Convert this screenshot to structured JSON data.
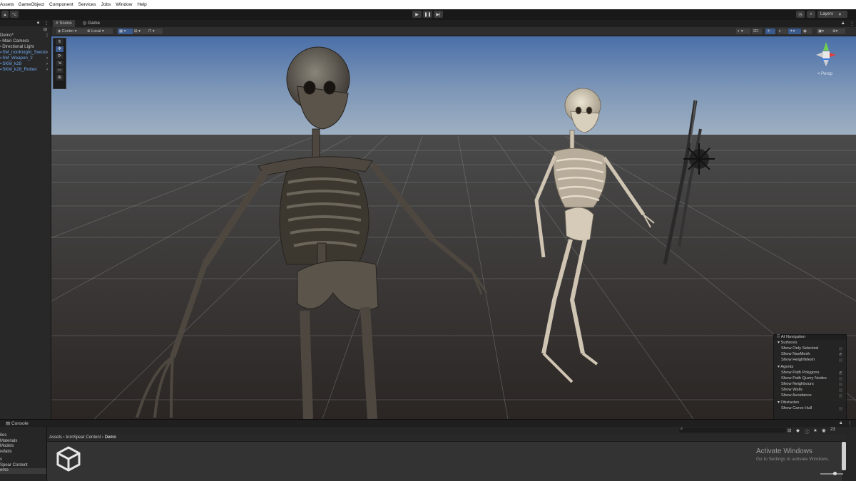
{
  "menu": [
    "Assets",
    "GameObject",
    "Component",
    "Services",
    "Jobs",
    "Window",
    "Help"
  ],
  "toolbar": {
    "layers_label": "Layers"
  },
  "hierarchy": {
    "scene_name": "Demo*",
    "items": [
      {
        "label": "Main Camera",
        "color": "#c8c8c8"
      },
      {
        "label": "Directional Light",
        "color": "#c8c8c8"
      },
      {
        "label": "SM_IronKnight_Sword",
        "color": "#6fa7ee"
      },
      {
        "label": "SM_Weapon_2",
        "color": "#6fa7ee"
      },
      {
        "label": "SKM_k28",
        "color": "#6fa7ee"
      },
      {
        "label": "SKM_k28_Rotten",
        "color": "#6fa7ee"
      }
    ]
  },
  "scene_tabs": {
    "scene": "Scene",
    "game": "Game"
  },
  "scene_toolbar": {
    "pivot": "Center",
    "space": "Local"
  },
  "gizmo": {
    "projection": "< Persp"
  },
  "ai_navigation": {
    "title": "AI Navigation",
    "sections": [
      {
        "name": "Surfaces",
        "options": [
          {
            "label": "Show Only Selected",
            "checked": false
          },
          {
            "label": "Show NavMesh",
            "checked": true
          },
          {
            "label": "Show HeightMesh",
            "checked": false
          }
        ]
      },
      {
        "name": "Agents",
        "options": [
          {
            "label": "Show Path Polygons",
            "checked": true
          },
          {
            "label": "Show Path Query Nodes",
            "checked": false
          },
          {
            "label": "Show Neighbours",
            "checked": false
          },
          {
            "label": "Show Walls",
            "checked": false
          },
          {
            "label": "Show Avoidance",
            "checked": false
          }
        ]
      },
      {
        "name": "Obstacles",
        "options": [
          {
            "label": "Show Carve Hull",
            "checked": false
          }
        ]
      }
    ]
  },
  "console": {
    "tab_label": "Console",
    "count": "23"
  },
  "project": {
    "tree": [
      "ites",
      "Materials",
      "Models",
      "refabs",
      "s",
      "Spear Content",
      "emo"
    ],
    "breadcrumb": [
      "Assets",
      "IronSpear Content",
      "Demo"
    ]
  },
  "watermark": {
    "line1": "Activate Windows",
    "line2": "Go to Settings to activate Windows."
  }
}
